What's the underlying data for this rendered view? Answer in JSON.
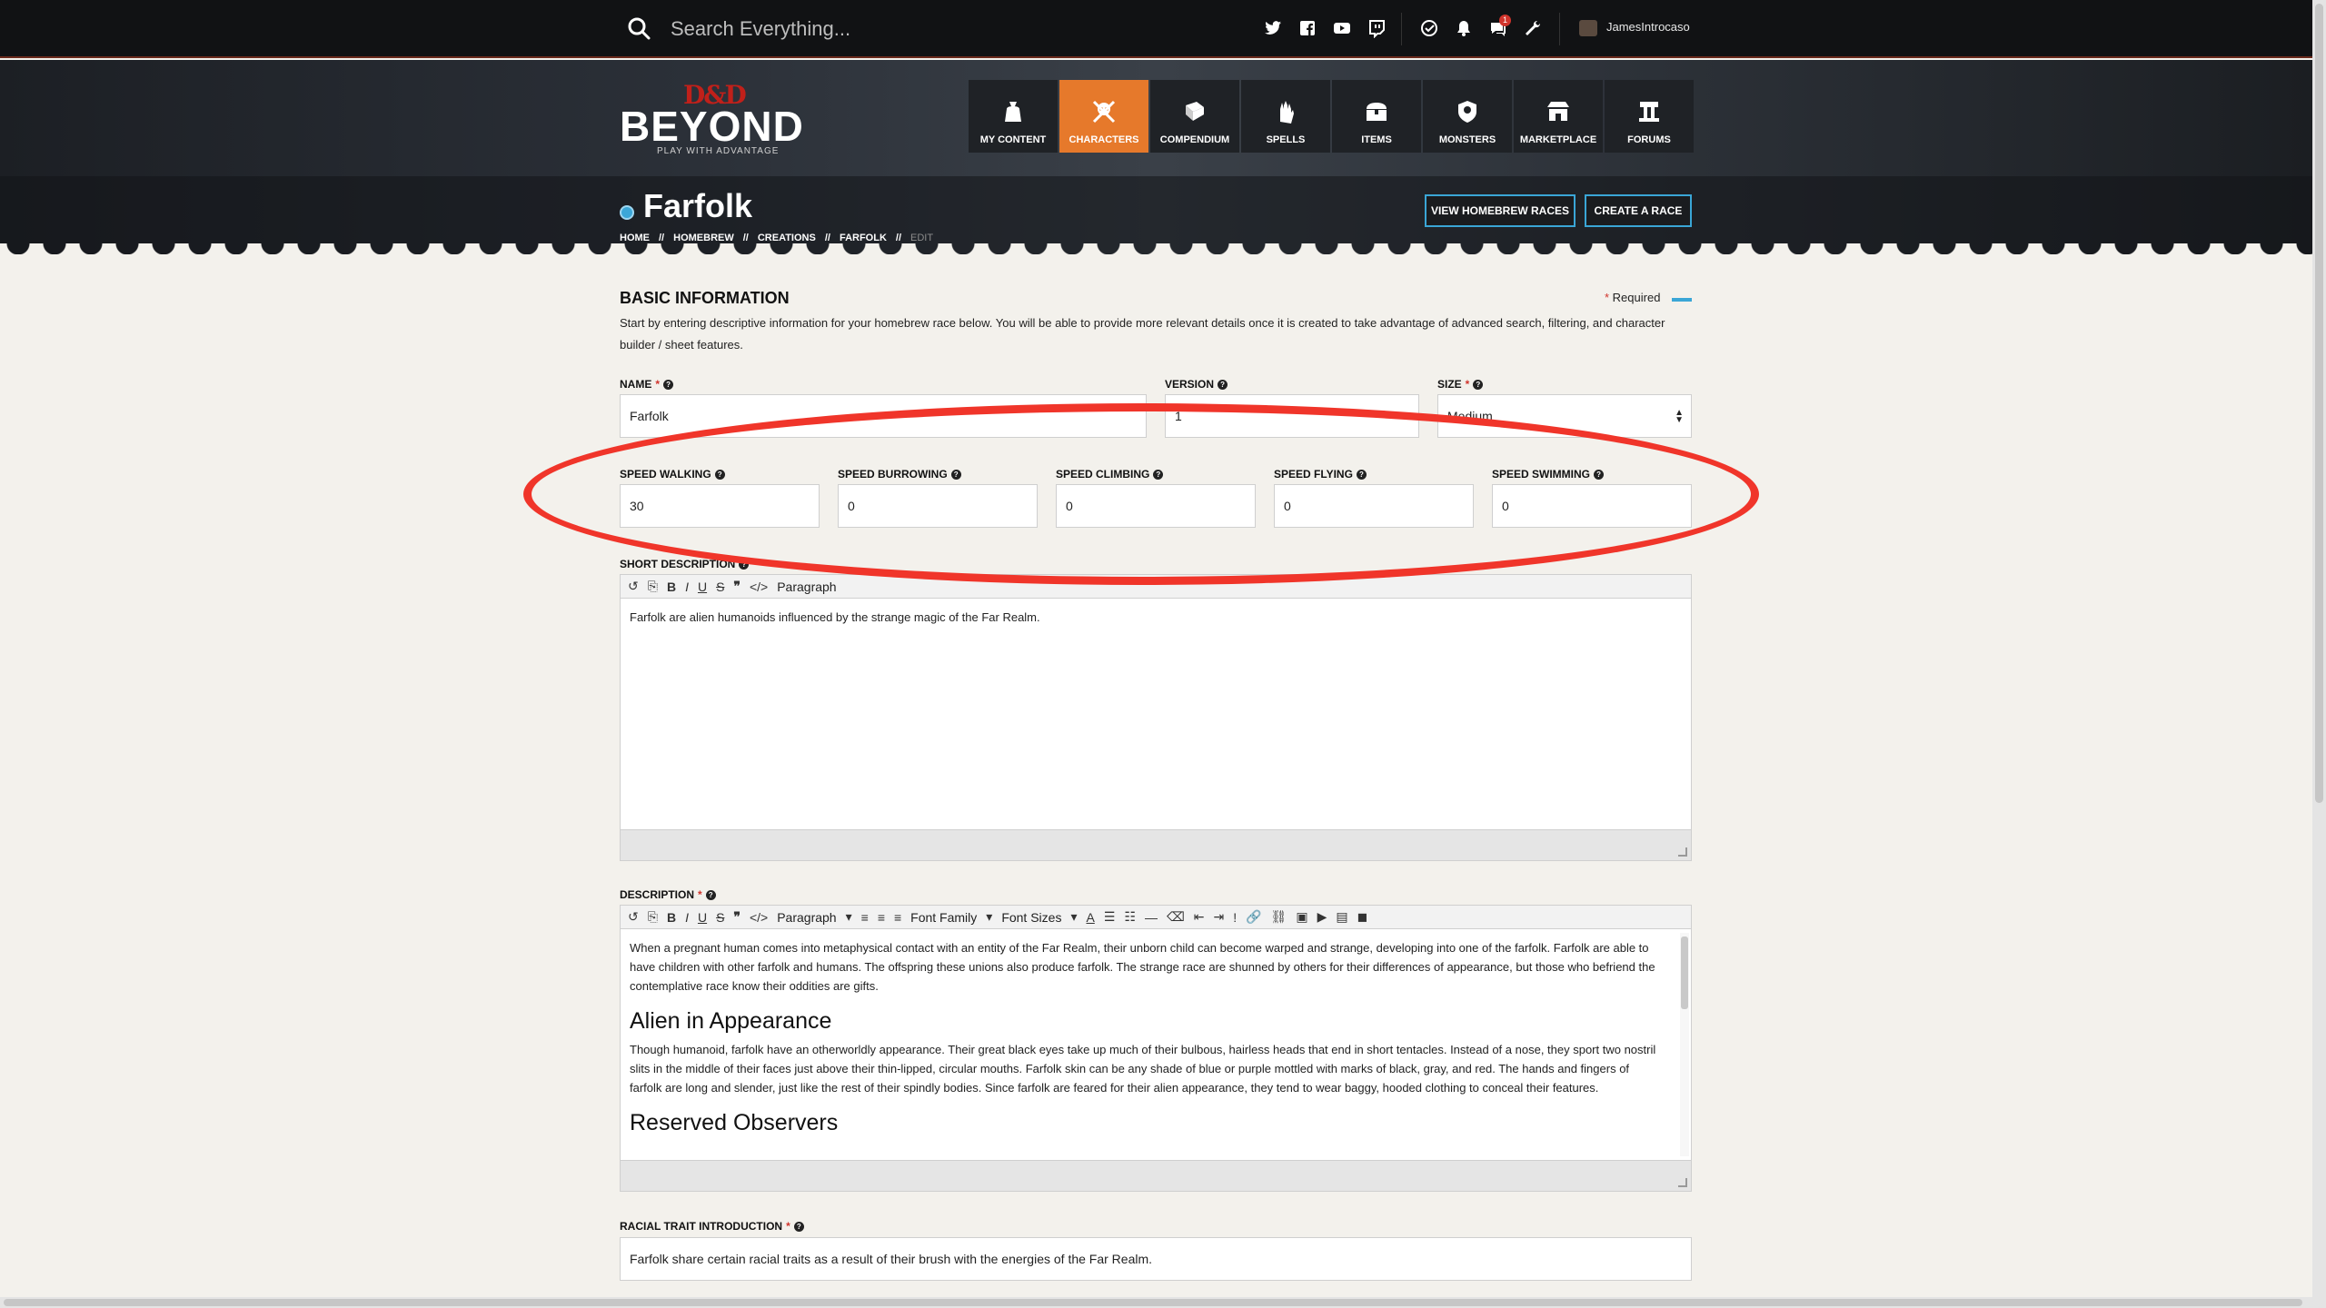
{
  "topbar": {
    "search_placeholder": "Search Everything...",
    "social_icons": [
      "twitter-icon",
      "facebook-icon",
      "youtube-icon",
      "twitch-icon"
    ],
    "utility_icons": [
      "dice-icon",
      "bell-icon",
      "chat-icon",
      "wrench-icon"
    ],
    "chat_badge_count": "1",
    "username": "JamesIntrocaso"
  },
  "logo": {
    "dd": "D&D",
    "beyond": "BEYOND",
    "tagline": "PLAY WITH ADVANTAGE"
  },
  "nav": [
    {
      "label": "MY CONTENT",
      "icon": "bag-icon",
      "active": false
    },
    {
      "label": "CHARACTERS",
      "icon": "skull-crossbones-icon",
      "active": true
    },
    {
      "label": "COMPENDIUM",
      "icon": "book-icon",
      "active": false
    },
    {
      "label": "SPELLS",
      "icon": "hand-spell-icon",
      "active": false
    },
    {
      "label": "ITEMS",
      "icon": "chest-icon",
      "active": false
    },
    {
      "label": "MONSTERS",
      "icon": "monster-shield-icon",
      "active": false
    },
    {
      "label": "MARKETPLACE",
      "icon": "store-icon",
      "active": false
    },
    {
      "label": "FORUMS",
      "icon": "forum-icon",
      "active": false
    }
  ],
  "page": {
    "title": "Farfolk",
    "breadcrumb": [
      "HOME",
      "HOMEBREW",
      "CREATIONS",
      "FARFOLK",
      "EDIT"
    ],
    "view_homebrew_button": "VIEW HOMEBREW RACES",
    "create_race_button": "CREATE A RACE"
  },
  "form": {
    "section_title": "BASIC INFORMATION",
    "required_label": "Required",
    "intro_text": "Start by entering descriptive information for your homebrew race below. You will be able to provide more relevant details once it is created to take advantage of advanced search, filtering, and character builder / sheet features.",
    "name": {
      "label": "NAME",
      "value": "Farfolk"
    },
    "version": {
      "label": "VERSION",
      "value": "1"
    },
    "size": {
      "label": "SIZE",
      "value": "Medium"
    },
    "speeds": [
      {
        "label": "SPEED WALKING",
        "value": "30"
      },
      {
        "label": "SPEED BURROWING",
        "value": "0"
      },
      {
        "label": "SPEED CLIMBING",
        "value": "0"
      },
      {
        "label": "SPEED FLYING",
        "value": "0"
      },
      {
        "label": "SPEED SWIMMING",
        "value": "0"
      }
    ],
    "short_description": {
      "label": "SHORT DESCRIPTION",
      "text": "Farfolk are alien humanoids influenced by the strange magic of the Far Realm."
    },
    "description": {
      "label": "DESCRIPTION",
      "toolbar_paragraph": "Paragraph",
      "toolbar_font_family": "Font Family",
      "toolbar_font_sizes": "Font Sizes",
      "p1": "When a pregnant human comes into metaphysical contact with an entity of the Far Realm, their unborn child can become warped and strange, developing into one of the farfolk. Farfolk are able to have children with other farfolk and humans. The offspring these unions also produce farfolk. The strange race are shunned by others for their differences of appearance, but those who befriend the contemplative race know their oddities are gifts.",
      "h2a": "Alien in Appearance",
      "p2": "Though humanoid, farfolk have an otherworldly appearance. Their great black eyes take up much of their bulbous, hairless heads that end in short tentacles. Instead of a nose, they sport two nostril slits in the middle of their faces just above their thin-lipped, circular mouths. Farfolk skin can be any shade of blue or purple mottled with marks of black, gray, and red. The hands and fingers of farfolk are long and slender, just like the rest of their spindly bodies. Since farfolk are feared for their alien appearance, they tend to wear baggy, hooded clothing to conceal their features.",
      "h2b": "Reserved Observers"
    },
    "racial_trait_intro": {
      "label": "RACIAL TRAIT INTRODUCTION",
      "value": "Farfolk share certain racial traits as a result of their brush with the energies of the Far Realm."
    }
  },
  "colors": {
    "accent_orange": "#e6792b",
    "accent_blue": "#3aa6d6",
    "required_red": "#d0342c",
    "annotation_red": "#f0352a"
  }
}
